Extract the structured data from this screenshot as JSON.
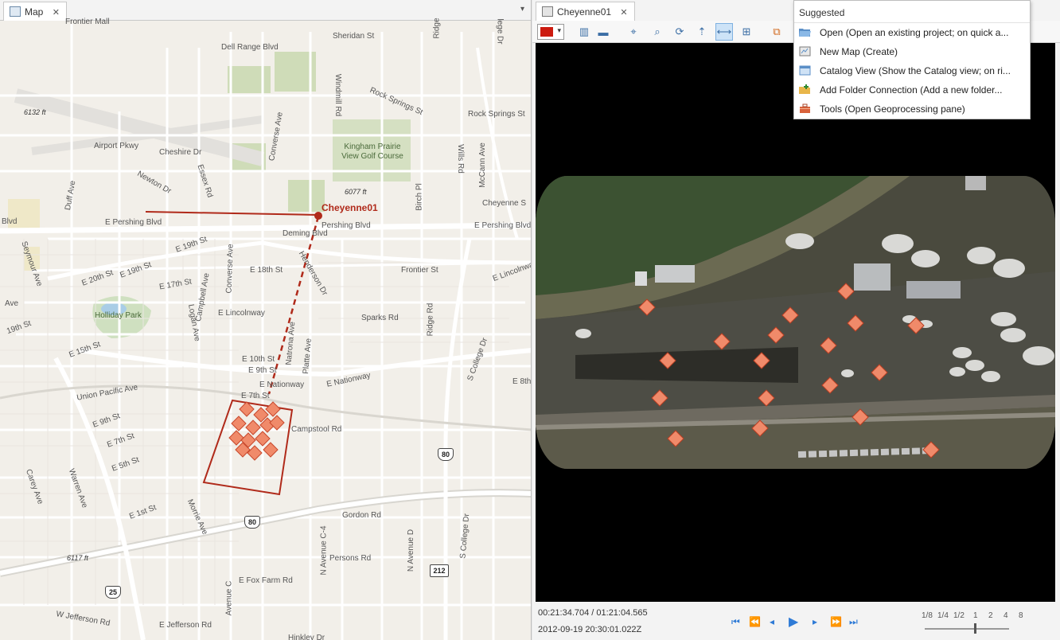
{
  "map_pane": {
    "tab_label": "Map",
    "close_glyph": "✕",
    "menu_glyph": "▾",
    "labels": {
      "frontier_mall": "Frontier Mall",
      "sheridan_st": "Sheridan St",
      "dell_range": "Dell Range Blvd",
      "ridge_rd_top": "Ridge",
      "college_top": "lege Dr",
      "rock_springs": "Rock Springs St",
      "rock_springs2": "Rock Springs St",
      "windmill": "Windmill Rd",
      "elev_6132": "6132 ft",
      "converse_top": "Converse Ave",
      "airport_pkwy": "Airport Pkwy",
      "cheshire": "Cheshire Dr",
      "kingham": "Kingham Prairie View Golf Course",
      "wills_rd": "Wills Rd",
      "mccann": "McCann Ave",
      "newton": "Newton Dr",
      "essex": "Essex Rd",
      "duff": "Duff Ave",
      "elev_6077": "6077 ft",
      "birch": "Birch Pl",
      "cheyenne_st": "Cheyenne S",
      "cheyenne01": "Cheyenne01",
      "blvd_left": "Blvd",
      "e_pershing": "E Pershing Blvd",
      "pershing_mid": "Pershing Blvd",
      "pershing_right": "E Pershing Blvd",
      "deming": "Deming Blvd",
      "seymour": "Seymour Ave",
      "e19_a": "E 19th St",
      "e19_b": "E 19th St",
      "e18": "E 18th St",
      "henderson": "Henderson Dr",
      "frontier_st": "Frontier St",
      "e_lincolnway_right": "E Lincolnwa",
      "e20": "E 20th St",
      "e17": "E 17th St",
      "converse_mid": "Converse Ave",
      "campbell": "Campbell Ave",
      "e_lincolnway": "E Lincolnway",
      "sparks": "Sparks Rd",
      "ridge_mid": "Ridge Rd",
      "holliday": "Holliday Park",
      "logan": "Logan Ave",
      "ave_left": "Ave",
      "e19_left": "19th St",
      "e15": "E 15th St",
      "e10": "E 10th St",
      "e9": "E 9th St",
      "natrona": "Natrona Ave",
      "platte": "Platte Ave",
      "s_college": "S College Dr",
      "e_nationway_a": "E Nationway",
      "e_nationway_b": "E Nationway",
      "e8_right": "E 8th",
      "union_pacific": "Union Pacific Ave",
      "e7": "E 7th St",
      "e9_left": "E 9th St",
      "e7_left": "E 7th St",
      "e5": "E 5th St",
      "campstool": "Campstool Rd",
      "carey": "Carey Ave",
      "warren": "Warren Ave",
      "e1st": "E 1st St",
      "morrie": "Morrie Ave",
      "gordon": "Gordon Rd",
      "s_college_low": "S College Dr",
      "n_ave_c4": "N Avenue C-4",
      "n_ave_d": "N Avenue D",
      "elev_6117": "6117 ft",
      "persons": "Persons Rd",
      "e_fox_farm": "E Fox Farm Rd",
      "ave_c": "Avenue C",
      "w_jefferson": "W Jefferson Rd",
      "e_jefferson": "E Jefferson Rd",
      "hinkley": "Hinkley Dr"
    },
    "shields": {
      "i80_a": "80",
      "i80_b": "80",
      "i25": "25",
      "r212": "212"
    }
  },
  "video_pane": {
    "tab_label": "Cheyenne01",
    "close_glyph": "✕",
    "color_caret": "▾",
    "current_color": "#cc1b10",
    "toolbar_icons": [
      "bookmark-icon",
      "measure-icon",
      "zoom-map-icon",
      "zoom-frame-icon",
      "rotate-icon",
      "north-icon",
      "track-icon",
      "add-point-icon",
      "export-icon"
    ],
    "time_position": "00:21:34.704 / 01:21:04.565",
    "timestamp": "2012-09-19 20:30:01.022Z",
    "playback_glyphs": {
      "to_start": "⏮",
      "rewind": "⏪",
      "step_back": "◂",
      "play": "▶",
      "step_forward": "▸",
      "fast_forward": "⏩",
      "to_end": "⏭"
    },
    "speeds": [
      "1/8",
      "1/4",
      "1/2",
      "1",
      "2",
      "4",
      "8"
    ],
    "speed_value": 1
  },
  "suggested": {
    "title": "Suggested",
    "items": [
      {
        "label": "Open (Open an existing project; on quick a...",
        "icon": "folder-open-icon"
      },
      {
        "label": "New Map (Create)",
        "icon": "new-map-icon"
      },
      {
        "label": "Catalog View (Show the Catalog view; on ri...",
        "icon": "catalog-icon"
      },
      {
        "label": "Add Folder Connection (Add a new folder...",
        "icon": "add-folder-icon"
      },
      {
        "label": "Tools (Open Geoprocessing pane)",
        "icon": "toolbox-icon"
      }
    ]
  },
  "colors": {
    "accent": "#2f7bd6",
    "footprint": "#b02a1a",
    "marker_fill": "#f08a6a",
    "map_bg": "#f2efe9"
  }
}
